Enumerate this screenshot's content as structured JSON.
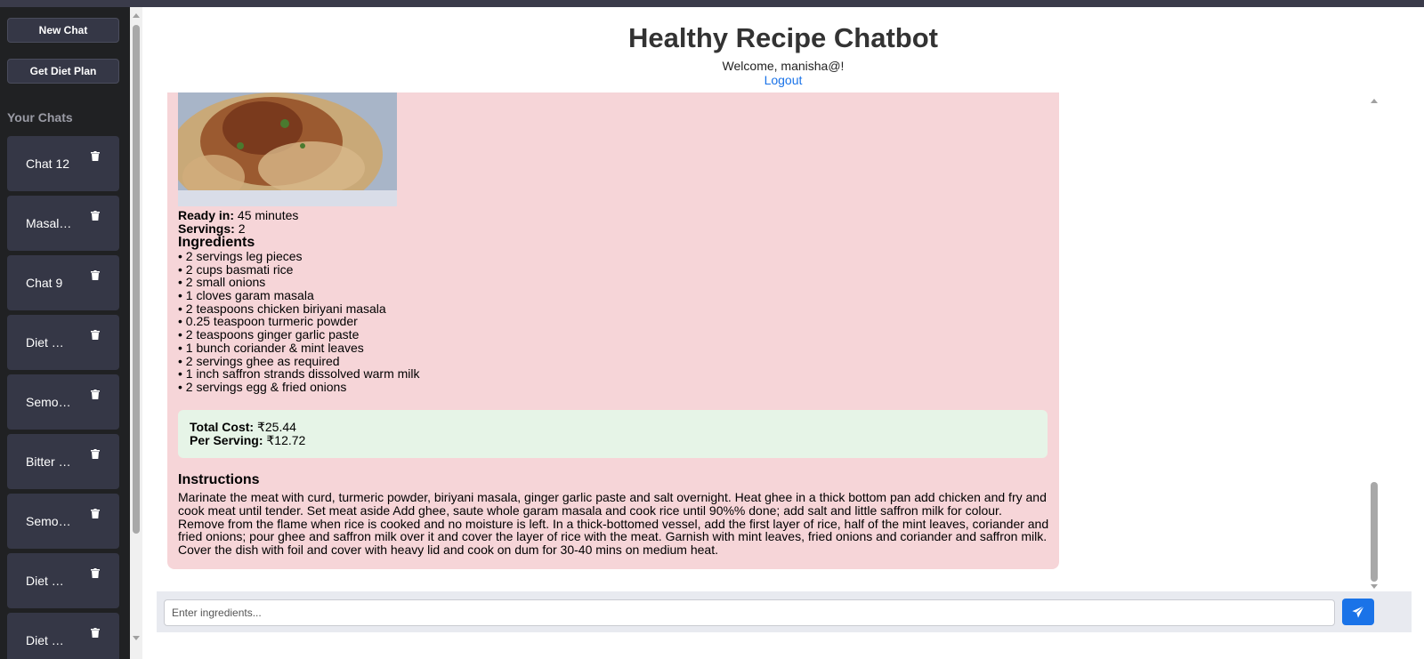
{
  "sidebar": {
    "new_chat": "New Chat",
    "diet_plan": "Get Diet Plan",
    "section_title": "Your Chats",
    "chats": [
      {
        "label": "Chat 12"
      },
      {
        "label": "Masal…"
      },
      {
        "label": "Chat 9"
      },
      {
        "label": "Diet …"
      },
      {
        "label": "Semo…"
      },
      {
        "label": "Bitter …"
      },
      {
        "label": "Semo…"
      },
      {
        "label": "Diet …"
      },
      {
        "label": "Diet …"
      }
    ]
  },
  "header": {
    "title": "Healthy Recipe Chatbot",
    "welcome": "Welcome, manisha@!",
    "logout": "Logout"
  },
  "recipe": {
    "ready_label": "Ready in:",
    "ready_value": "45 minutes",
    "servings_label": "Servings:",
    "servings_value": "2",
    "ingredients_heading": "Ingredients",
    "ingredients": [
      "• 2 servings leg pieces",
      "• 2 cups basmati rice",
      "• 2 small onions",
      "• 1 cloves garam masala",
      "• 2 teaspoons chicken biriyani masala",
      "• 0.25 teaspoon turmeric powder",
      "• 2 teaspoons ginger garlic paste",
      "• 1 bunch coriander & mint leaves",
      "• 2 servings ghee as required",
      "• 1 inch saffron strands dissolved warm milk",
      "• 2 servings egg & fried onions"
    ],
    "total_cost_label": "Total Cost:",
    "total_cost_value": "₹25.44",
    "per_serving_label": "Per Serving:",
    "per_serving_value": "₹12.72",
    "instructions_heading": "Instructions",
    "instructions": "Marinate the meat with curd, turmeric powder, biriyani masala, ginger garlic paste and salt overnight. Heat ghee in a thick bottom pan add chicken and fry and cook meat until tender. Set meat aside Add ghee, saute whole garam masala and cook rice until 90%% done; add salt and little saffron milk for colour. Remove from the flame when rice is cooked and no moisture is left. In a thick-bottomed vessel, add the first layer of rice, half of the mint leaves, coriander and fried onions; pour ghee and saffron milk over it and cover the layer of rice with the meat. Garnish with mint leaves, fried onions and coriander and saffron milk. Cover the dish with foil and cover with heavy lid and cook on dum for 30-40 mins on medium heat."
  },
  "composer": {
    "placeholder": "Enter ingredients..."
  },
  "colors": {
    "sidebar_bg": "#202123",
    "chat_item_bg": "#353746",
    "card_bg": "#f6d5d8",
    "cost_bg": "#e6f4e7",
    "accent": "#1a73e8"
  },
  "icons": {
    "trash": "trash-icon",
    "send": "paper-plane-icon"
  }
}
